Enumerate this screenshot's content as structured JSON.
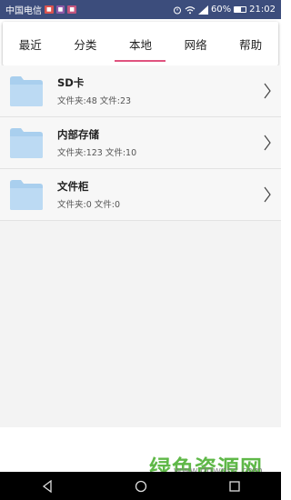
{
  "status_bar": {
    "carrier": "中国电信",
    "battery": "60%",
    "time": "21:02",
    "battery_level": 0.6
  },
  "tabs": [
    {
      "label": "最近",
      "active": false
    },
    {
      "label": "分类",
      "active": false
    },
    {
      "label": "本地",
      "active": true
    },
    {
      "label": "网络",
      "active": false
    },
    {
      "label": "帮助",
      "active": false
    }
  ],
  "locations": [
    {
      "name": "SD卡",
      "meta": "文件夹:48 文件:23",
      "icon": "folder-icon"
    },
    {
      "name": "内部存储",
      "meta": "文件夹:123 文件:10",
      "icon": "folder-icon"
    },
    {
      "name": "文件柜",
      "meta": "文件夹:0 文件:0",
      "icon": "folder-icon"
    }
  ],
  "watermark": {
    "text": "绿色资源网",
    "url": "www.downcc.com"
  },
  "colors": {
    "status_bar": "#3c4d7c",
    "tab_indicator": "#e0537f",
    "folder": "#a9cfee",
    "watermark": "#5fb848"
  }
}
